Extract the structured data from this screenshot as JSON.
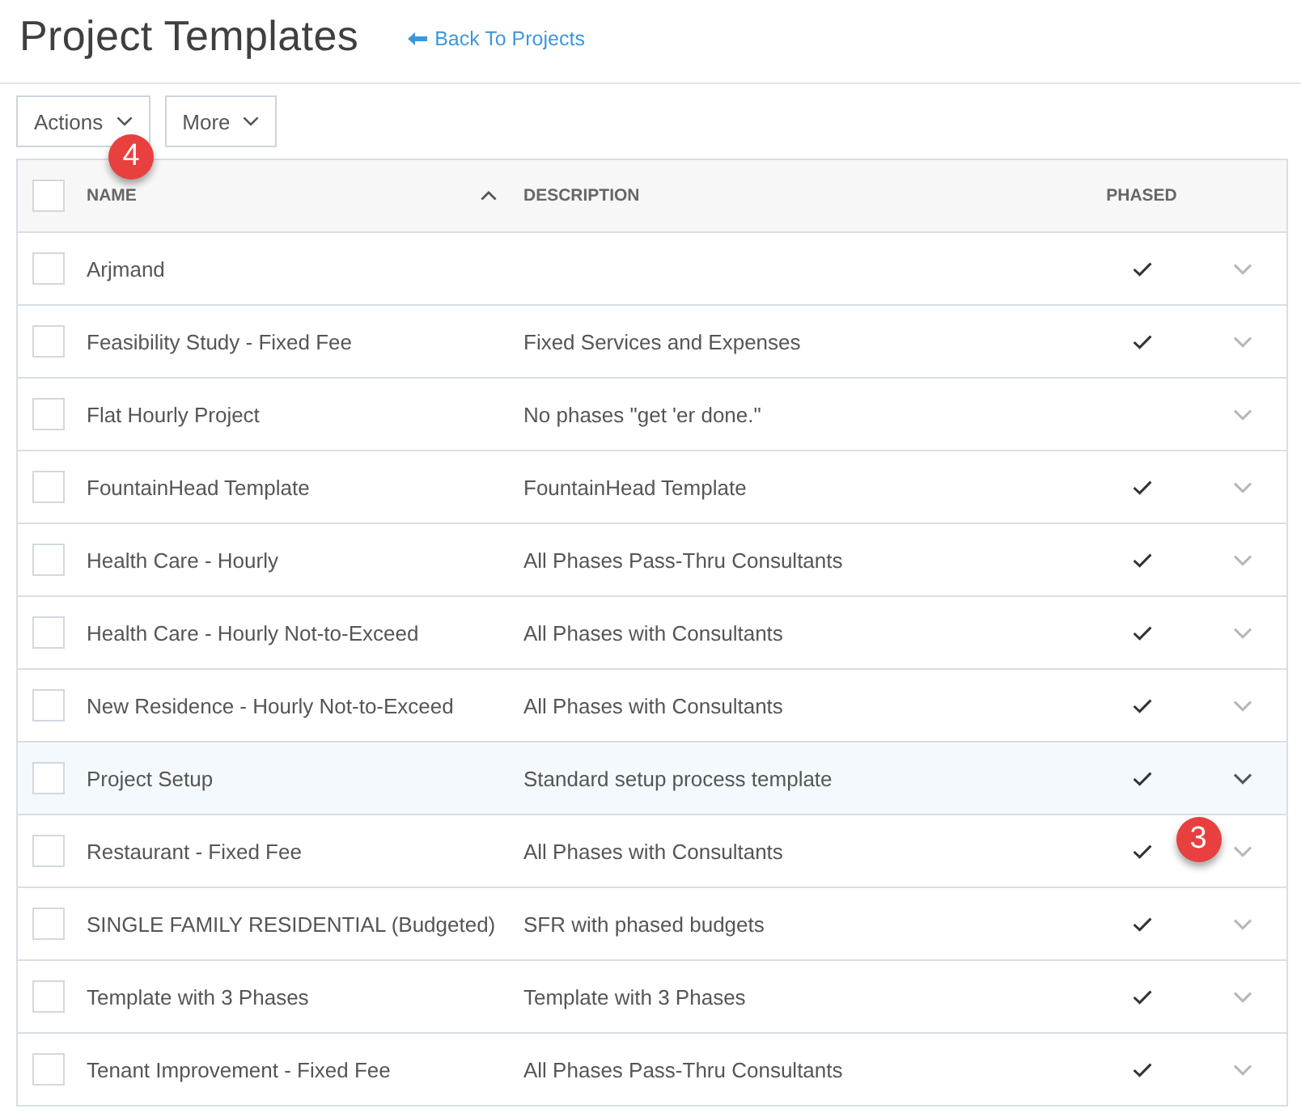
{
  "page": {
    "title": "Project Templates",
    "back_link": "Back To Projects"
  },
  "toolbar": {
    "buttons": [
      {
        "label": "Actions",
        "callout": "4"
      },
      {
        "label": "More"
      }
    ]
  },
  "table": {
    "select_all": {
      "checked": false
    },
    "columns": [
      {
        "label": "NAME",
        "sorted": true,
        "ascending": true
      },
      {
        "label": "DESCRIPTION"
      },
      {
        "label": "PHASED"
      }
    ],
    "rows": [
      {
        "checked": false,
        "name": "Arjmand",
        "phased": true,
        "hovered": false
      },
      {
        "checked": false,
        "name": "Feasibility Study - Fixed Fee",
        "description": "Fixed Services and Expenses",
        "phased": true,
        "hovered": false
      },
      {
        "checked": false,
        "name": "Flat Hourly Project",
        "description": "No phases \"get 'er done.\"",
        "phased": false,
        "hovered": false
      },
      {
        "checked": false,
        "name": "FountainHead Template",
        "description": "FountainHead Template",
        "phased": true,
        "hovered": false
      },
      {
        "checked": false,
        "name": "Health Care - Hourly",
        "description": "All Phases Pass-Thru Consultants",
        "phased": true,
        "hovered": false
      },
      {
        "checked": false,
        "name": "Health Care - Hourly Not-to-Exceed",
        "description": "All Phases with Consultants",
        "phased": true,
        "hovered": false
      },
      {
        "checked": false,
        "name": "New Residence - Hourly Not-to-Exceed",
        "description": "All Phases with Consultants",
        "phased": true,
        "hovered": false
      },
      {
        "checked": false,
        "name": "Project Setup",
        "description": "Standard setup process template",
        "phased": true,
        "hovered": true
      },
      {
        "checked": false,
        "name": "Restaurant - Fixed Fee",
        "description": "All Phases with Consultants",
        "phased": true,
        "hovered": false,
        "callout": "3"
      },
      {
        "checked": false,
        "name": "SINGLE FAMILY RESIDENTIAL (Budgeted)",
        "description": "SFR with phased budgets",
        "phased": true,
        "hovered": false
      },
      {
        "checked": false,
        "name": "Template with 3 Phases",
        "description": "Template with 3 Phases",
        "phased": true,
        "hovered": false
      },
      {
        "checked": false,
        "name": "Tenant Improvement - Fixed Fee",
        "description": "All Phases Pass-Thru Consultants",
        "phased": true,
        "hovered": false
      }
    ]
  }
}
